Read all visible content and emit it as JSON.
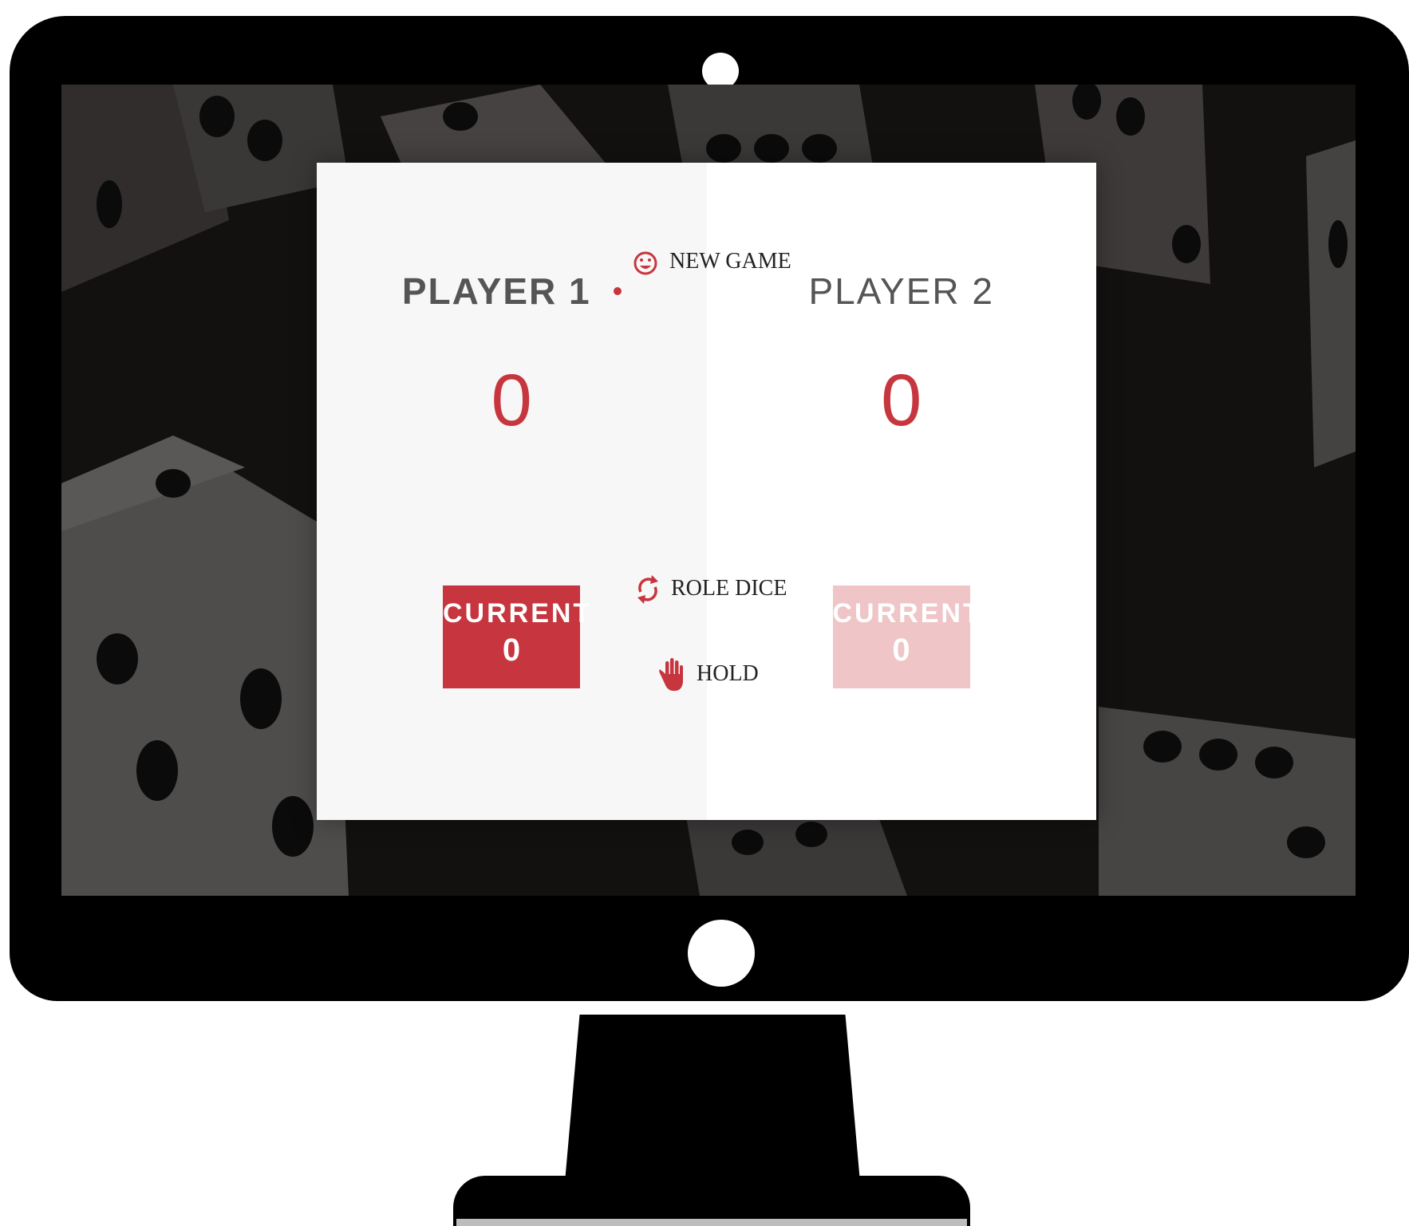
{
  "game": {
    "new_game_label": "NEW GAME",
    "roll_dice_label": "ROLE DICE",
    "hold_label": "HOLD",
    "active_player": 1,
    "players": [
      {
        "name": "PLAYER 1",
        "score": "0",
        "current_label": "CURRENT",
        "current_score": "0"
      },
      {
        "name": "PLAYER 2",
        "score": "0",
        "current_label": "CURRENT",
        "current_score": "0"
      }
    ]
  },
  "icons": {
    "new_game": "smile-icon",
    "roll_dice": "refresh-icon",
    "hold": "hand-icon"
  },
  "colors": {
    "accent": "#c7363e",
    "accent_faded": "#efc5c7",
    "active_panel": "#f7f7f7",
    "idle_panel": "#ffffff",
    "text_gray": "#555555"
  }
}
